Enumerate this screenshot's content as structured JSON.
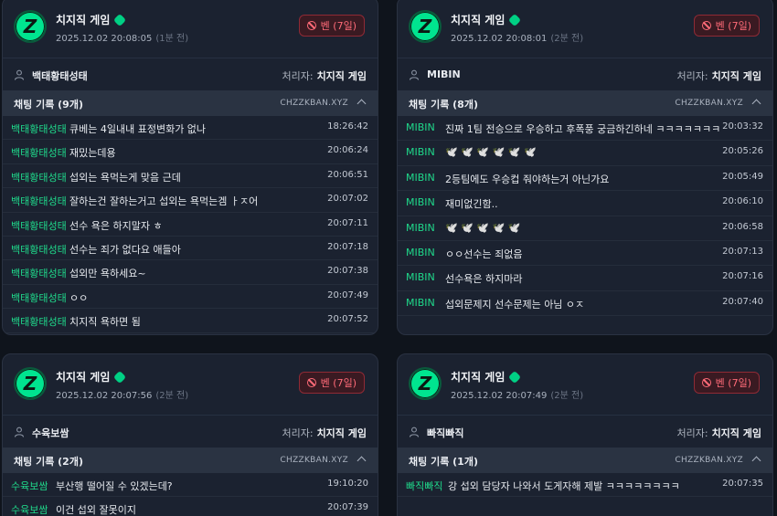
{
  "ban_label": "벤 (7일)",
  "processor_label": "처리자:",
  "site": "CHZZKBAN.XYZ",
  "cards": [
    {
      "channel": "치지직 게임",
      "logo": "Z",
      "timestamp": "2025.12.02 20:08:05",
      "ago": "(1분 전)",
      "user": "백태황태성태",
      "processor": "치지직 게임",
      "chat_title": "채팅 기록 (9개)",
      "messages": [
        {
          "nick": "백태황태성태",
          "text": "큐베는 4일내내 표정변화가 없나",
          "time": "18:26:42"
        },
        {
          "nick": "백태황태성태",
          "text": "재밌는데용",
          "time": "20:06:24"
        },
        {
          "nick": "백태황태성태",
          "text": "섭외는 욕먹는게 맞음 근데",
          "time": "20:06:51"
        },
        {
          "nick": "백태황태성태",
          "text": "잘하는건 잘하는거고 섭외는 욕먹는겜 ㅏㅈ어",
          "time": "20:07:02"
        },
        {
          "nick": "백태황태성태",
          "text": "선수 욕은 하지말자 ㅎ",
          "time": "20:07:11"
        },
        {
          "nick": "백태황태성태",
          "text": "선수는 죄가 없다요 애들아",
          "time": "20:07:18"
        },
        {
          "nick": "백태황태성태",
          "text": "섭외만 욕하세요~",
          "time": "20:07:38"
        },
        {
          "nick": "백태황태성태",
          "text": "ㅇㅇ",
          "time": "20:07:49"
        },
        {
          "nick": "백태황태성태",
          "text": "치지직 욕하면 됨",
          "time": "20:07:52"
        }
      ]
    },
    {
      "channel": "치지직 게임",
      "logo": "Z",
      "timestamp": "2025.12.02 20:08:01",
      "ago": "(2분 전)",
      "user": "MIBIN",
      "processor": "치지직 게임",
      "chat_title": "채팅 기록 (8개)",
      "messages": [
        {
          "nick": "MIBIN",
          "text": "진짜 1팀 전승으로 우승하고 후폭풍 궁금하긴하네 ㅋㅋㅋㅋㅋㅋㅋ",
          "time": "20:03:32"
        },
        {
          "nick": "MIBIN",
          "text": "🕊️ 🕊️ 🕊️ 🕊️ 🕊️ 🕊️",
          "time": "20:05:26"
        },
        {
          "nick": "MIBIN",
          "text": "2등팀에도 우승컵 줘야하는거 아닌가요",
          "time": "20:05:49"
        },
        {
          "nick": "MIBIN",
          "text": "재미없긴함..",
          "time": "20:06:10"
        },
        {
          "nick": "MIBIN",
          "text": "🕊️ 🕊️ 🕊️ 🕊️ 🕊️",
          "time": "20:06:58"
        },
        {
          "nick": "MIBIN",
          "text": "ㅇㅇ선수는 죄없음",
          "time": "20:07:13"
        },
        {
          "nick": "MIBIN",
          "text": "선수욕은 하지마라",
          "time": "20:07:16"
        },
        {
          "nick": "MIBIN",
          "text": "섭외문제지 선수문제는 아님 ㅇㅈ",
          "time": "20:07:40"
        }
      ]
    },
    {
      "channel": "치지직 게임",
      "logo": "Z",
      "timestamp": "2025.12.02 20:07:56",
      "ago": "(2분 전)",
      "user": "수육보쌈",
      "processor": "치지직 게임",
      "chat_title": "채팅 기록 (2개)",
      "messages": [
        {
          "nick": "수육보쌈",
          "text": "부산행 떨어질 수 있겠는데?",
          "time": "19:10:20"
        },
        {
          "nick": "수육보쌈",
          "text": "이건 섭외 잘못이지",
          "time": "20:07:39"
        }
      ]
    },
    {
      "channel": "치지직 게임",
      "logo": "Z",
      "timestamp": "2025.12.02 20:07:49",
      "ago": "(2분 전)",
      "user": "빠직빠직",
      "processor": "치지직 게임",
      "chat_title": "채팅 기록 (1개)",
      "messages": [
        {
          "nick": "빠직빠직",
          "text": "강 섭외 담당자 나와서 도게자해 제발 ㅋㅋㅋㅋㅋㅋㅋㅋ",
          "time": "20:07:35"
        }
      ]
    }
  ],
  "colors": {
    "background": "#0f141c",
    "card": "#1b2230",
    "nick": "#1fd98b",
    "ban": "#ff6b78",
    "logo": "#00e58f"
  }
}
